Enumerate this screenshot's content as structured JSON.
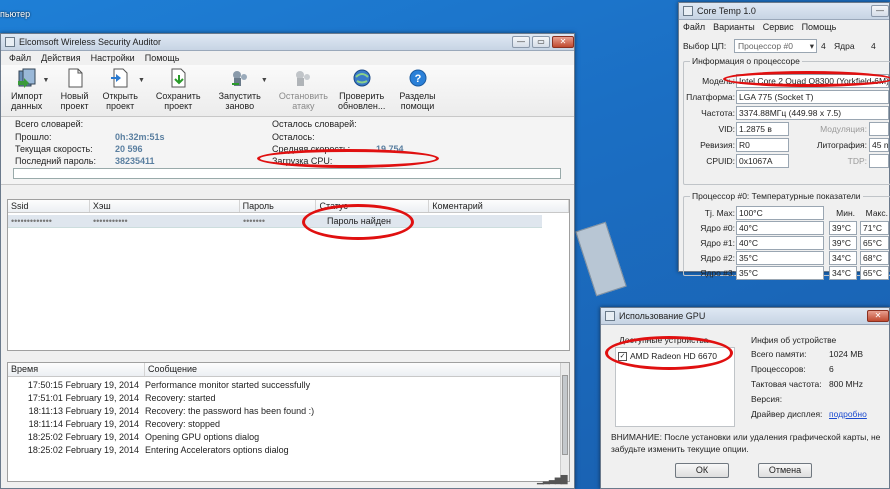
{
  "desktop": {
    "label": "пьютер"
  },
  "main": {
    "title": "Elcomsoft Wireless Security Auditor",
    "menu": [
      "Файл",
      "Действия",
      "Настройки",
      "Помощь"
    ],
    "toolbar": [
      {
        "label": "Импорт\nданных",
        "icon": "import-icon",
        "has_arrow": true
      },
      {
        "label": "Новый\nпроект",
        "icon": "new-project-icon"
      },
      {
        "label": "Открыть\nпроект",
        "icon": "open-project-icon",
        "has_arrow": true
      },
      {
        "label": "Сохранить\nпроект",
        "icon": "save-project-icon"
      },
      {
        "label": "Запустить\nзаново",
        "icon": "restart-icon",
        "has_arrow": true
      },
      {
        "label": "Остановить\nатаку",
        "icon": "stop-attack-icon",
        "disabled": true
      },
      {
        "label": "Проверить\nобновлен...",
        "icon": "check-updates-icon"
      },
      {
        "label": "Разделы\nпомощи",
        "icon": "help-icon"
      }
    ],
    "stats": {
      "total_dicts_label": "Всего словарей:",
      "elapsed_label": "Прошло:",
      "elapsed_value": "0h:32m:51s",
      "speed_label": "Текущая скорость:",
      "speed_value": "20 596",
      "last_pwd_label": "Последний пароль:",
      "last_pwd_value": "38235411",
      "remaining_dicts_label": "Осталось словарей:",
      "remaining_label": "Осталось:",
      "avg_speed_label": "Средняя скорость:",
      "avg_speed_value": "19 754",
      "cpu_label": "Загрузка CPU:"
    },
    "list": {
      "columns": [
        "Ssid",
        "Хэш",
        "Пароль",
        "Статус",
        "Коментарий"
      ],
      "row": {
        "ssid": "•••••••••••••",
        "hash": "•••••••••••",
        "password": "•••••••",
        "status": "Пароль найден",
        "comment": ""
      }
    },
    "log": {
      "columns": [
        "Время",
        "Сообщение"
      ],
      "rows": [
        {
          "time": "17:50:15 February 19, 2014",
          "msg": "Performance monitor started successfully"
        },
        {
          "time": "17:51:01 February 19, 2014",
          "msg": "Recovery: started"
        },
        {
          "time": "18:11:13 February 19, 2014",
          "msg": "Recovery: the password has been found :)"
        },
        {
          "time": "18:11:14 February 19, 2014",
          "msg": "Recovery: stopped"
        },
        {
          "time": "18:25:02 February 19, 2014",
          "msg": "Opening GPU options dialog"
        },
        {
          "time": "18:25:02 February 19, 2014",
          "msg": "Entering Accelerators options dialog"
        }
      ]
    }
  },
  "coretemp": {
    "title": "Core Temp 1.0",
    "menu": [
      "Файл",
      "Варианты",
      "Сервис",
      "Помощь"
    ],
    "cpu_select_label": "Выбор ЦП:",
    "cpu_select_value": "Процессор #0",
    "cores_count": "4",
    "cores_label": "Ядра",
    "threads_count": "4",
    "info_group": "Информация о процессоре",
    "model_label": "Модель:",
    "model_value": "Intel Core 2 Quad Q8300 (Yorkfield-6M)",
    "platform_label": "Платформа:",
    "platform_value": "LGA 775 (Socket T)",
    "freq_label": "Частота:",
    "freq_value": "3374.88МГц (449.98 x 7.5)",
    "vid_label": "VID:",
    "vid_value": "1.2875 в",
    "modulation_label": "Модуляция:",
    "revision_label": "Ревизия:",
    "revision_value": "R0",
    "litho_label": "Литография:",
    "litho_value": "45 n",
    "cpuid_label": "CPUID:",
    "cpuid_value": "0x1067A",
    "tdp_label": "TDP:",
    "temp_group": "Процессор #0: Температурные показатели",
    "tjmax_label": "Tj. Max:",
    "tjmax_value": "100°C",
    "min_label": "Мин.",
    "max_label": "Макс.",
    "cores": [
      {
        "label": "Ядро #0:",
        "cur": "40°C",
        "min": "39°C",
        "max": "71°C"
      },
      {
        "label": "Ядро #1:",
        "cur": "40°C",
        "min": "39°C",
        "max": "65°C"
      },
      {
        "label": "Ядро #2:",
        "cur": "35°C",
        "min": "34°C",
        "max": "68°C"
      },
      {
        "label": "Ядро #3:",
        "cur": "35°C",
        "min": "34°C",
        "max": "65°C"
      }
    ]
  },
  "gpu": {
    "title": "Использование GPU",
    "devices_label": "Доступные устройства",
    "device_name": "AMD Radeon HD 6670",
    "device_info_label": "Инфия об устройстве",
    "memory_label": "Всего памяти:",
    "memory_value": "1024 MB",
    "processors_label": "Процессоров:",
    "processors_value": "6",
    "clock_label": "Тактовая частота:",
    "clock_value": "800 MHz",
    "version_label": "Версия:",
    "driver_label": "Драйвер дисплея:",
    "driver_link": "подробно",
    "warning": "ВНИМАНИЕ: После установки или удаления графической карты, не забудьте изменить текущие опции.",
    "ok_label": "ОК",
    "cancel_label": "Отмена"
  }
}
